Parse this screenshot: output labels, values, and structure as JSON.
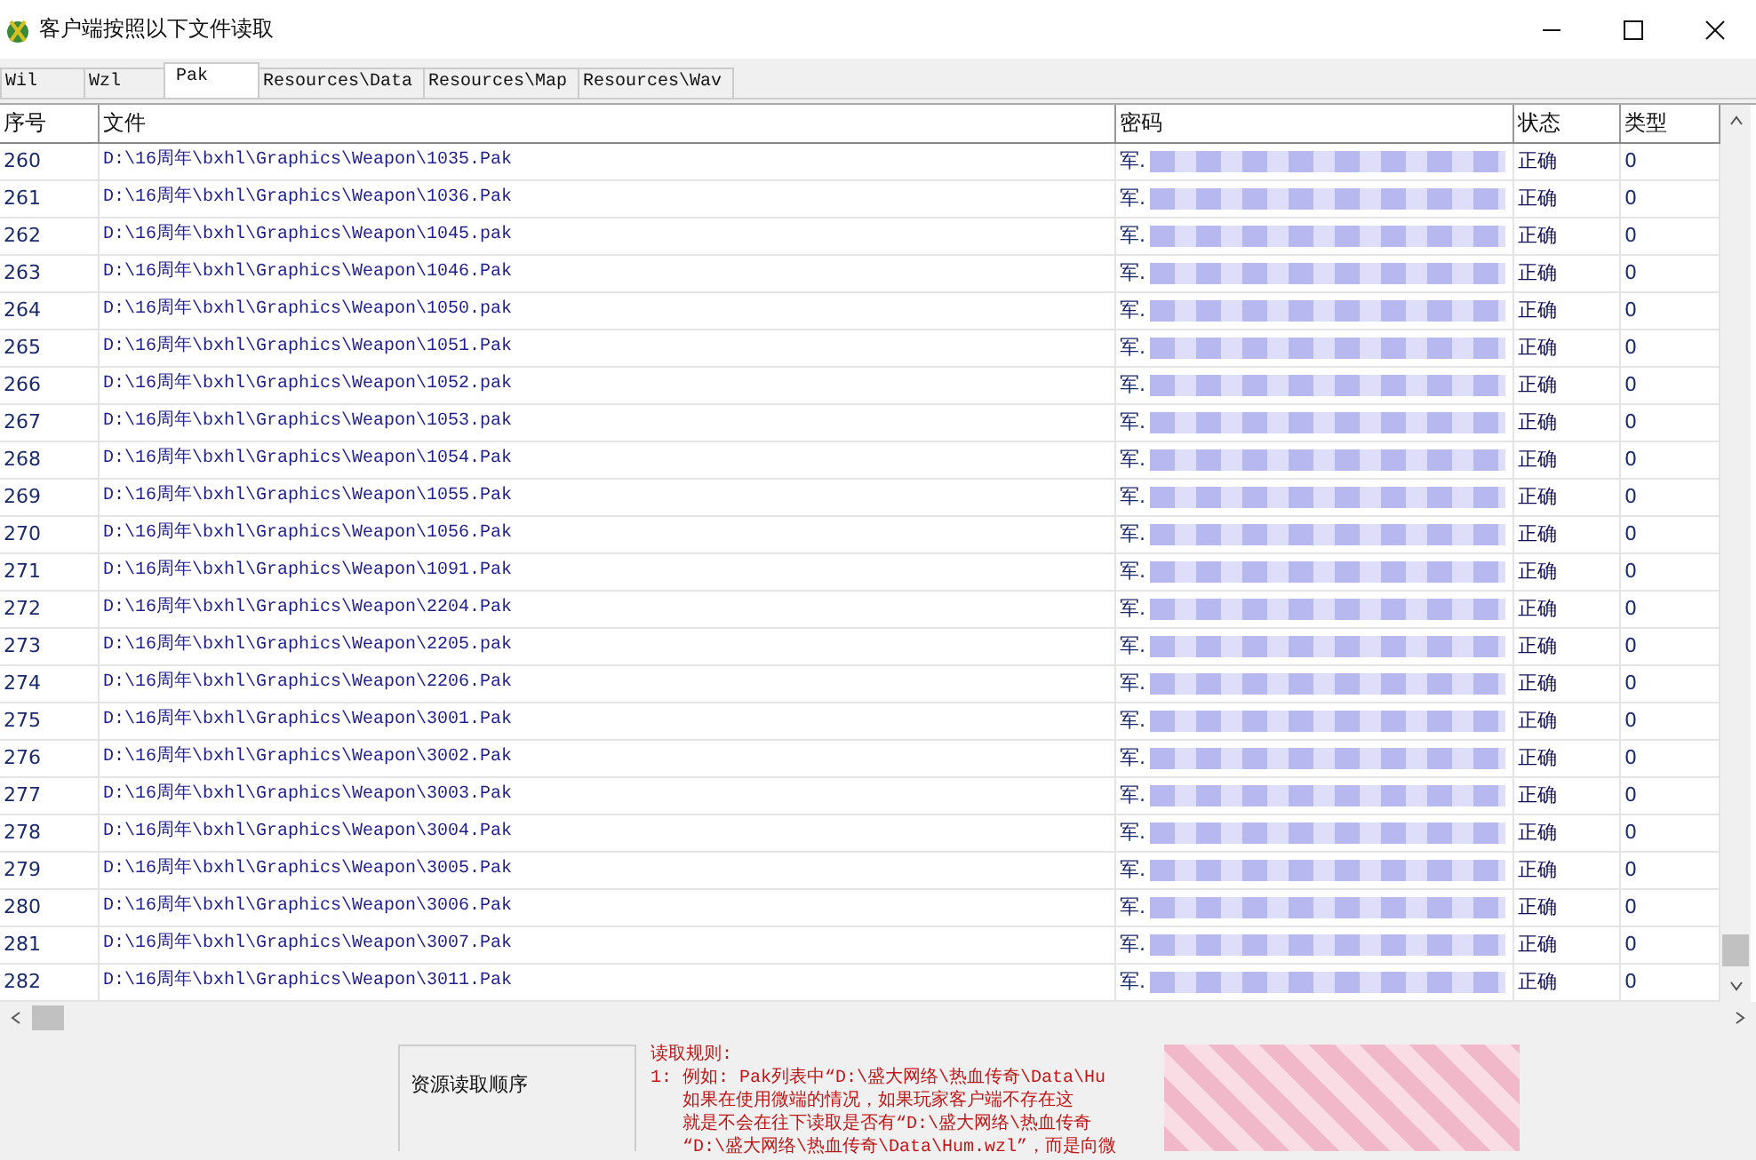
{
  "window": {
    "title": "客户端按照以下文件读取"
  },
  "tabs": [
    {
      "label": "Wil",
      "selected": false
    },
    {
      "label": "Wzl",
      "selected": false
    },
    {
      "label": "Pak",
      "selected": true
    },
    {
      "label": "Resources\\Data",
      "selected": false
    },
    {
      "label": "Resources\\Map",
      "selected": false
    },
    {
      "label": "Resources\\Wav",
      "selected": false
    }
  ],
  "table": {
    "columns": [
      "序号",
      "文件",
      "密码",
      "状态",
      "类型"
    ],
    "rows": [
      {
        "index": "260",
        "file": "D:\\16周年\\bxhl\\Graphics\\Weapon\\1035.Pak",
        "password": "军.",
        "status": "正确",
        "type": "0"
      },
      {
        "index": "261",
        "file": "D:\\16周年\\bxhl\\Graphics\\Weapon\\1036.Pak",
        "password": "军.",
        "status": "正确",
        "type": "0"
      },
      {
        "index": "262",
        "file": "D:\\16周年\\bxhl\\Graphics\\Weapon\\1045.pak",
        "password": "军.",
        "status": "正确",
        "type": "0"
      },
      {
        "index": "263",
        "file": "D:\\16周年\\bxhl\\Graphics\\Weapon\\1046.Pak",
        "password": "军.",
        "status": "正确",
        "type": "0"
      },
      {
        "index": "264",
        "file": "D:\\16周年\\bxhl\\Graphics\\Weapon\\1050.pak",
        "password": "军.",
        "status": "正确",
        "type": "0"
      },
      {
        "index": "265",
        "file": "D:\\16周年\\bxhl\\Graphics\\Weapon\\1051.Pak",
        "password": "军.",
        "status": "正确",
        "type": "0"
      },
      {
        "index": "266",
        "file": "D:\\16周年\\bxhl\\Graphics\\Weapon\\1052.pak",
        "password": "军.",
        "status": "正确",
        "type": "0"
      },
      {
        "index": "267",
        "file": "D:\\16周年\\bxhl\\Graphics\\Weapon\\1053.pak",
        "password": "军.",
        "status": "正确",
        "type": "0"
      },
      {
        "index": "268",
        "file": "D:\\16周年\\bxhl\\Graphics\\Weapon\\1054.Pak",
        "password": "军.",
        "status": "正确",
        "type": "0"
      },
      {
        "index": "269",
        "file": "D:\\16周年\\bxhl\\Graphics\\Weapon\\1055.Pak",
        "password": "军.",
        "status": "正确",
        "type": "0"
      },
      {
        "index": "270",
        "file": "D:\\16周年\\bxhl\\Graphics\\Weapon\\1056.Pak",
        "password": "军.",
        "status": "正确",
        "type": "0"
      },
      {
        "index": "271",
        "file": "D:\\16周年\\bxhl\\Graphics\\Weapon\\1091.Pak",
        "password": "军.",
        "status": "正确",
        "type": "0"
      },
      {
        "index": "272",
        "file": "D:\\16周年\\bxhl\\Graphics\\Weapon\\2204.Pak",
        "password": "军.",
        "status": "正确",
        "type": "0"
      },
      {
        "index": "273",
        "file": "D:\\16周年\\bxhl\\Graphics\\Weapon\\2205.pak",
        "password": "军.",
        "status": "正确",
        "type": "0"
      },
      {
        "index": "274",
        "file": "D:\\16周年\\bxhl\\Graphics\\Weapon\\2206.Pak",
        "password": "军.",
        "status": "正确",
        "type": "0"
      },
      {
        "index": "275",
        "file": "D:\\16周年\\bxhl\\Graphics\\Weapon\\3001.Pak",
        "password": "军.",
        "status": "正确",
        "type": "0"
      },
      {
        "index": "276",
        "file": "D:\\16周年\\bxhl\\Graphics\\Weapon\\3002.Pak",
        "password": "军.",
        "status": "正确",
        "type": "0"
      },
      {
        "index": "277",
        "file": "D:\\16周年\\bxhl\\Graphics\\Weapon\\3003.Pak",
        "password": "军.",
        "status": "正确",
        "type": "0"
      },
      {
        "index": "278",
        "file": "D:\\16周年\\bxhl\\Graphics\\Weapon\\3004.Pak",
        "password": "军.",
        "status": "正确",
        "type": "0"
      },
      {
        "index": "279",
        "file": "D:\\16周年\\bxhl\\Graphics\\Weapon\\3005.Pak",
        "password": "军.",
        "status": "正确",
        "type": "0"
      },
      {
        "index": "280",
        "file": "D:\\16周年\\bxhl\\Graphics\\Weapon\\3006.Pak",
        "password": "军.",
        "status": "正确",
        "type": "0"
      },
      {
        "index": "281",
        "file": "D:\\16周年\\bxhl\\Graphics\\Weapon\\3007.Pak",
        "password": "军.",
        "status": "正确",
        "type": "0"
      },
      {
        "index": "282",
        "file": "D:\\16周年\\bxhl\\Graphics\\Weapon\\3011.Pak",
        "password": "军.",
        "status": "正确",
        "type": "0"
      }
    ]
  },
  "order_panel": {
    "label": "资源读取顺序"
  },
  "rules": {
    "title": "读取规则:",
    "lines": [
      "1: 例如: Pak列表中“D:\\盛大网络\\热血传奇\\Data\\Hu",
      "如果在使用微端的情况，如果玩家客户端不存在这",
      "就是不会在往下读取是否有“D:\\盛大网络\\热血传奇",
      "“D:\\盛大网络\\热血传奇\\Data\\Hum.wzl”，而是向微"
    ]
  }
}
